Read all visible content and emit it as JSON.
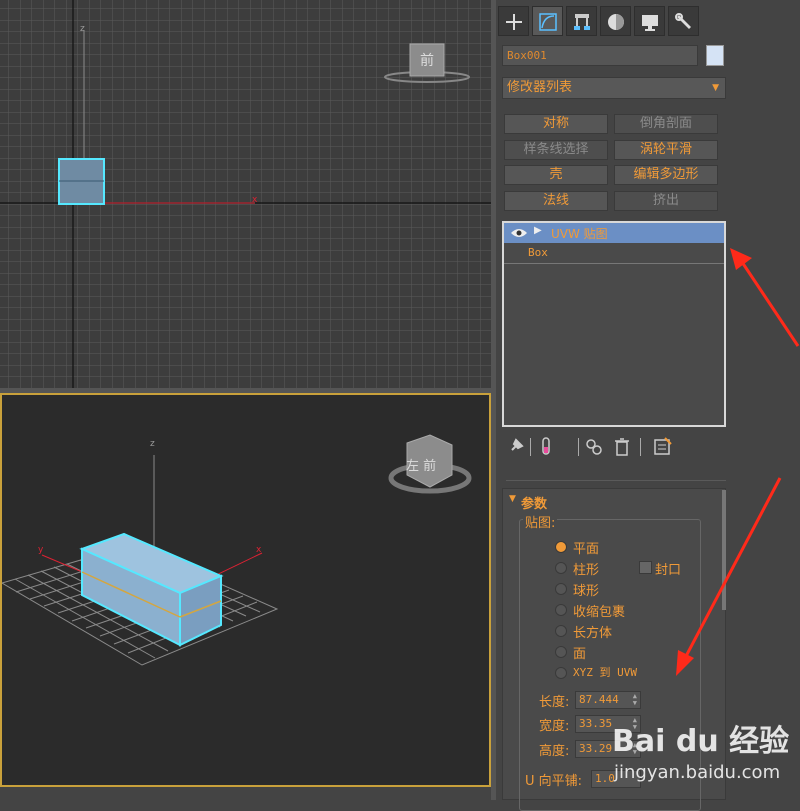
{
  "viewport_top": {
    "axis_z": "z",
    "axis_x": "x",
    "viewcube_label": "前"
  },
  "viewport_perspective": {
    "axis_z": "z",
    "axis_x": "x",
    "axis_y": "y",
    "viewcube_label": "左 前"
  },
  "command_panel": {
    "tabs": [
      "create-tab",
      "modify-tab",
      "hierarchy-tab",
      "motion-tab",
      "display-tab",
      "utilities-tab"
    ],
    "object_name": "Box001",
    "object_color": "#d5e3f5",
    "modifier_list_label": "修改器列表",
    "modifier_buttons": [
      {
        "label": "对称",
        "enabled": true
      },
      {
        "label": "倒角剖面",
        "enabled": false
      },
      {
        "label": "样条线选择",
        "enabled": false
      },
      {
        "label": "涡轮平滑",
        "enabled": true
      },
      {
        "label": "壳",
        "enabled": true
      },
      {
        "label": "编辑多边形",
        "enabled": true
      },
      {
        "label": "法线",
        "enabled": true
      },
      {
        "label": "挤出",
        "enabled": false
      }
    ],
    "stack": {
      "item1": "UVW 贴图",
      "item2": "Box"
    },
    "rollout": {
      "title": "参数",
      "group_label": "贴图:",
      "options": [
        "平面",
        "柱形",
        "球形",
        "收缩包裹",
        "长方体",
        "面",
        "XYZ 到 UVW"
      ],
      "selected_option": "平面",
      "cap_label": "封口",
      "length_label": "长度:",
      "length_value": "87.444",
      "width_label": "宽度:",
      "width_value": "33.35",
      "height_label": "高度:",
      "height_value": "33.29",
      "u_tile_label": "U 向平铺:",
      "u_tile_value": "1.0"
    }
  },
  "watermark": {
    "brand": "Bai du 经验",
    "url": "jingyan.baidu.com"
  },
  "colors": {
    "accent": "#f09a38",
    "selection": "#55e8ff",
    "stack_highlight": "#6b8fc5",
    "annotation_arrow": "#ff2a1a"
  }
}
